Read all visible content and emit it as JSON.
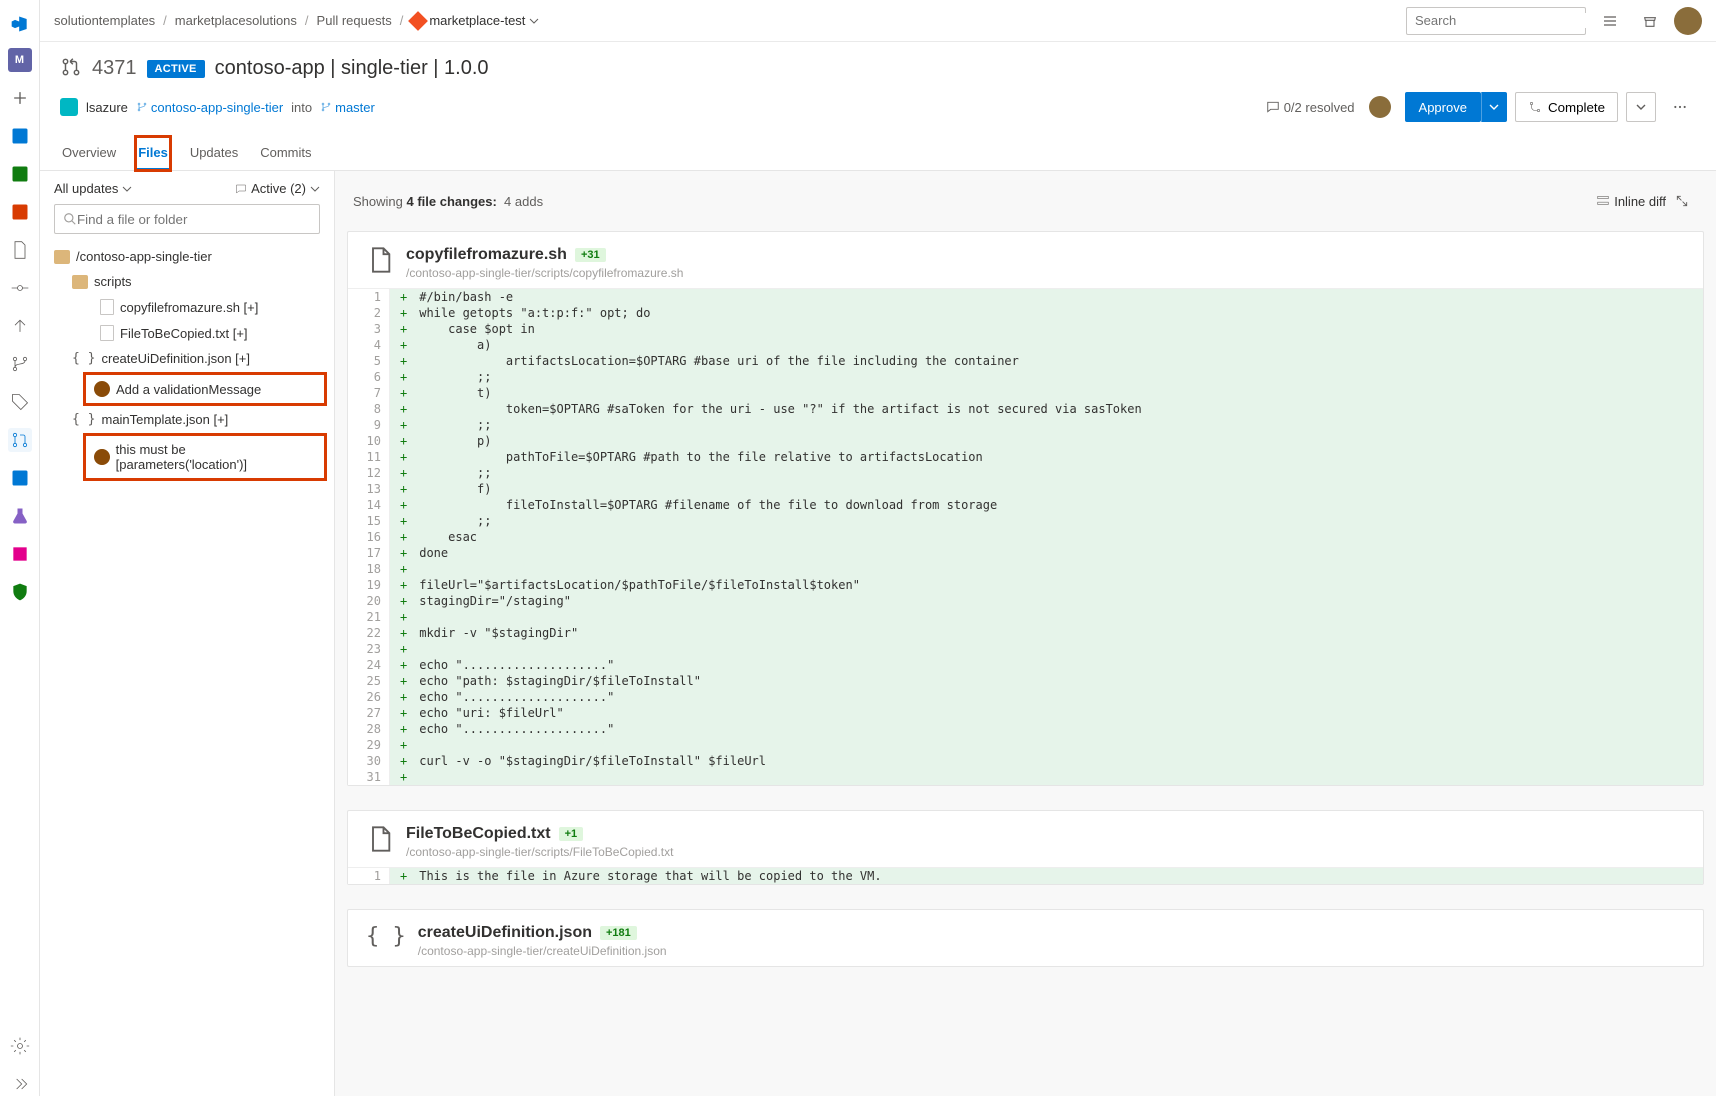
{
  "breadcrumbs": [
    "solutiontemplates",
    "marketplacesolutions",
    "Pull requests",
    "marketplace-test"
  ],
  "search": {
    "placeholder": "Search"
  },
  "pr": {
    "id": "4371",
    "status": "ACTIVE",
    "title": "contoso-app | single-tier | 1.0.0",
    "author": "lsazure",
    "source_branch": "contoso-app-single-tier",
    "into": "into",
    "target_branch": "master",
    "resolved": "0/2 resolved",
    "approve": "Approve",
    "complete": "Complete"
  },
  "tabs": [
    "Overview",
    "Files",
    "Updates",
    "Commits"
  ],
  "sidepanel": {
    "filter1": "All updates",
    "filter2": "Active (2)",
    "find_placeholder": "Find a file or folder",
    "root": "/contoso-app-single-tier",
    "folder_scripts": "scripts",
    "file1": "copyfilefromazure.sh [+]",
    "file2": "FileToBeCopied.txt [+]",
    "file3": "createUiDefinition.json [+]",
    "comment1": "Add a validationMessage",
    "file4": "mainTemplate.json [+]",
    "comment2": "this must be [parameters('location')]"
  },
  "contentbar": {
    "showing_pre": "Showing ",
    "changes": "4 file changes:",
    "adds": "4 adds",
    "inline": "Inline diff"
  },
  "files": [
    {
      "name": "copyfilefromazure.sh",
      "delta": "+31",
      "path": "/contoso-app-single-tier/scripts/copyfilefromazure.sh",
      "lines": [
        "#/bin/bash -e",
        "while getopts \"a:t:p:f:\" opt; do",
        "    case $opt in",
        "        a)",
        "            artifactsLocation=$OPTARG #base uri of the file including the container",
        "        ;;",
        "        t)",
        "            token=$OPTARG #saToken for the uri - use \"?\" if the artifact is not secured via sasToken",
        "        ;;",
        "        p)",
        "            pathToFile=$OPTARG #path to the file relative to artifactsLocation",
        "        ;;",
        "        f)",
        "            fileToInstall=$OPTARG #filename of the file to download from storage",
        "        ;;",
        "    esac",
        "done",
        "",
        "fileUrl=\"$artifactsLocation/$pathToFile/$fileToInstall$token\"",
        "stagingDir=\"/staging\"",
        "",
        "mkdir -v \"$stagingDir\"",
        "",
        "echo \"....................\"",
        "echo \"path: $stagingDir/$fileToInstall\"",
        "echo \"....................\"",
        "echo \"uri: $fileUrl\"",
        "echo \"....................\"",
        "",
        "curl -v -o \"$stagingDir/$fileToInstall\" $fileUrl",
        ""
      ]
    },
    {
      "name": "FileToBeCopied.txt",
      "delta": "+1",
      "path": "/contoso-app-single-tier/scripts/FileToBeCopied.txt",
      "lines": [
        "This is the file in Azure storage that will be copied to the VM."
      ]
    },
    {
      "name": "createUiDefinition.json",
      "delta": "+181",
      "path": "/contoso-app-single-tier/createUiDefinition.json",
      "lines": []
    }
  ]
}
